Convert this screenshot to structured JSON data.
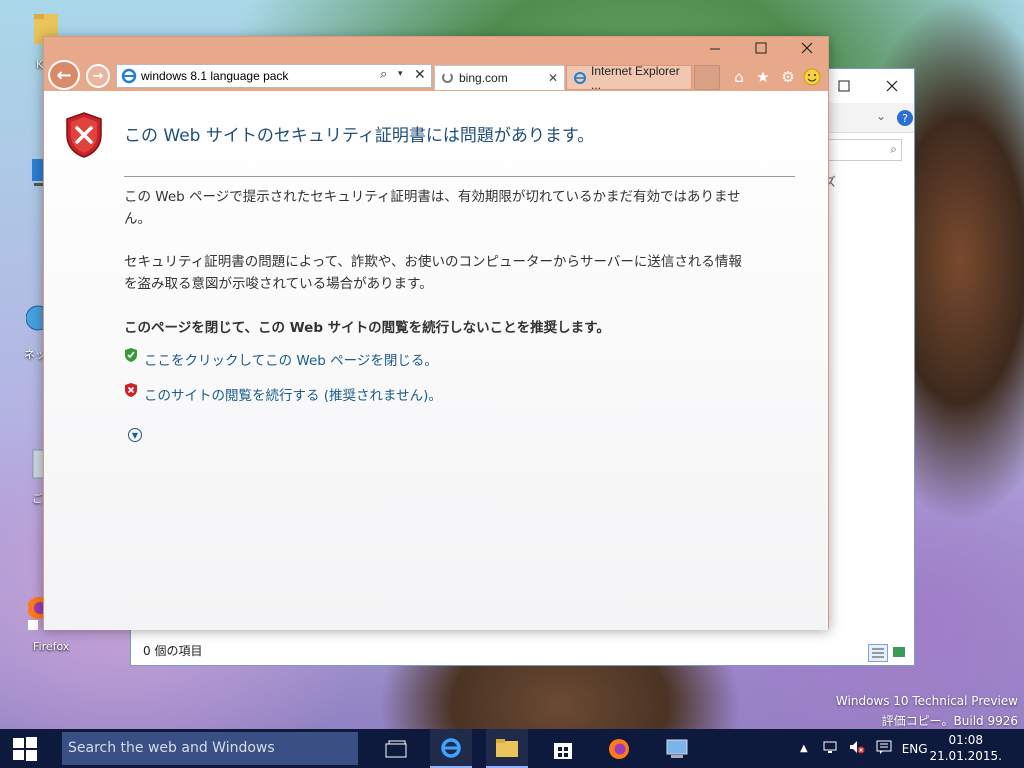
{
  "desktop": {
    "icons": [
      {
        "label": "K",
        "icon": "folder-icon"
      },
      {
        "label": "",
        "icon": "computer-icon"
      },
      {
        "label": "ネッ",
        "icon": "network-icon"
      },
      {
        "label": "ご",
        "icon": "recycle-bin-icon"
      },
      {
        "label": "Firefox",
        "icon": "firefox-icon"
      }
    ]
  },
  "explorer": {
    "status": "0 個の項目",
    "fragment": "ズ"
  },
  "ie": {
    "address": "windows 8.1 language pack",
    "tabs": [
      {
        "label": "bing.com",
        "active": true
      },
      {
        "label": "Internet Explorer ...",
        "active": false
      }
    ],
    "content": {
      "heading": "この Web サイトのセキュリティ証明書には問題があります。",
      "para1_line1": "この Web ページで提示されたセキュリティ証明書は、有効期限が切れているかまだ有効ではありませ",
      "para1_line2": "ん。",
      "para2_line1": "セキュリティ証明書の問題によって、詐欺や、お使いのコンピューターからサーバーに送信される情報",
      "para2_line2": "を盗み取る意図が示唆されている場合があります。",
      "recommend": "このページを閉じて、この Web サイトの閲覧を続行しないことを推奨します。",
      "link_close": "ここをクリックしてこの Web ページを閉じる。",
      "link_continue": "このサイトの閲覧を続行する (推奨されません)。"
    },
    "colors": {
      "frame": "#e8a88a",
      "heading": "#1f4e79",
      "link": "#1a5d8a"
    }
  },
  "watermark": {
    "line1": "Windows 10 Technical Preview",
    "line2": "評価コピー。Build 9926"
  },
  "taskbar": {
    "search_placeholder": "Search the web and Windows",
    "lang": "ENG",
    "time": "01:08",
    "date": "21.01.2015."
  }
}
